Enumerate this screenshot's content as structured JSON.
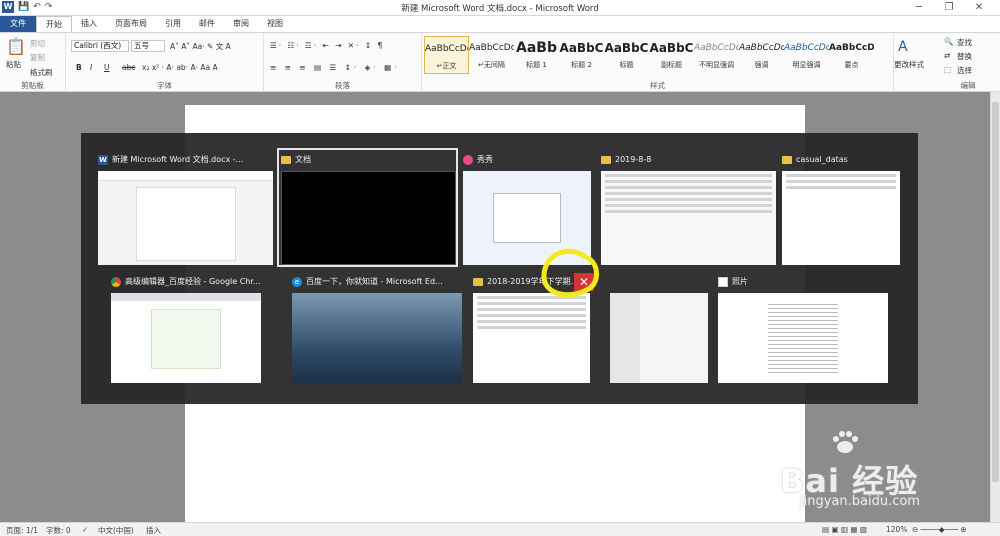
{
  "window": {
    "title": "新建 Microsoft Word 文档.docx - Microsoft Word",
    "quick_access": [
      "W",
      "💾",
      "↶",
      "↷"
    ],
    "controls": [
      "─",
      "❐",
      "✕"
    ]
  },
  "tabs": [
    "文件",
    "开始",
    "插入",
    "页面布局",
    "引用",
    "邮件",
    "审阅",
    "视图"
  ],
  "ribbon": {
    "clipboard": {
      "label": "剪贴板",
      "paste": "粘贴",
      "cut": "剪切",
      "copy": "复制",
      "format_painter": "格式刷"
    },
    "font": {
      "label": "字体",
      "font_name": "Calibri (西文)",
      "font_size": "五号",
      "bold": "B",
      "italic": "I",
      "underline": "U",
      "strike": "abc"
    },
    "paragraph": {
      "label": "段落"
    },
    "styles": {
      "label": "样式",
      "items": [
        {
          "sample": "AaBbCcDd",
          "name": "↵正文"
        },
        {
          "sample": "AaBbCcDd",
          "name": "↵无间隔"
        },
        {
          "sample": "AaBb",
          "name": "标题 1"
        },
        {
          "sample": "AaBbC",
          "name": "标题 2"
        },
        {
          "sample": "AaBbC",
          "name": "标题"
        },
        {
          "sample": "AaBbC",
          "name": "副标题"
        },
        {
          "sample": "AaBbCcDd",
          "name": "不明显强调"
        },
        {
          "sample": "AaBbCcDd",
          "name": "强调"
        },
        {
          "sample": "AaBbCcDc",
          "name": "明显强调"
        },
        {
          "sample": "AaBbCcDc",
          "name": "要点"
        }
      ],
      "change_styles": "更改样式"
    },
    "editing": {
      "label": "编辑",
      "find": "查找",
      "replace": "替换",
      "select": "选择"
    }
  },
  "switcher": {
    "windows": [
      {
        "title": "新建 Microsoft Word 文档.docx -...",
        "icon": "word-icon"
      },
      {
        "title": "文档",
        "icon": "folder-icon"
      },
      {
        "title": "秀秀",
        "icon": "meitu-icon"
      },
      {
        "title": "2019-8-8",
        "icon": "folder-icon"
      },
      {
        "title": "casual_datas",
        "icon": "folder-icon"
      },
      {
        "title": "高级编辑器_百度经验 - Google Chr...",
        "icon": "chrome-icon"
      },
      {
        "title": "百度一下，你就知道 - Microsoft Ed...",
        "icon": "edge-icon"
      },
      {
        "title": "2018-2019学年下学期...",
        "icon": "folder-icon"
      },
      {
        "title": "",
        "icon": "wechat-icon"
      },
      {
        "title": "照片",
        "icon": "photos-icon"
      }
    ],
    "close_symbol": "✕"
  },
  "status": {
    "page": "页面: 1/1",
    "words": "字数: 0",
    "language": "中文(中国)",
    "mode": "插入",
    "zoom": "120%"
  },
  "watermark": {
    "main": "Bai 经验",
    "sub": "jingyan.baidu.com"
  },
  "colors": {
    "word_blue": "#2b579a",
    "close_red": "#d9333a",
    "switcher_bg": "#262626"
  }
}
